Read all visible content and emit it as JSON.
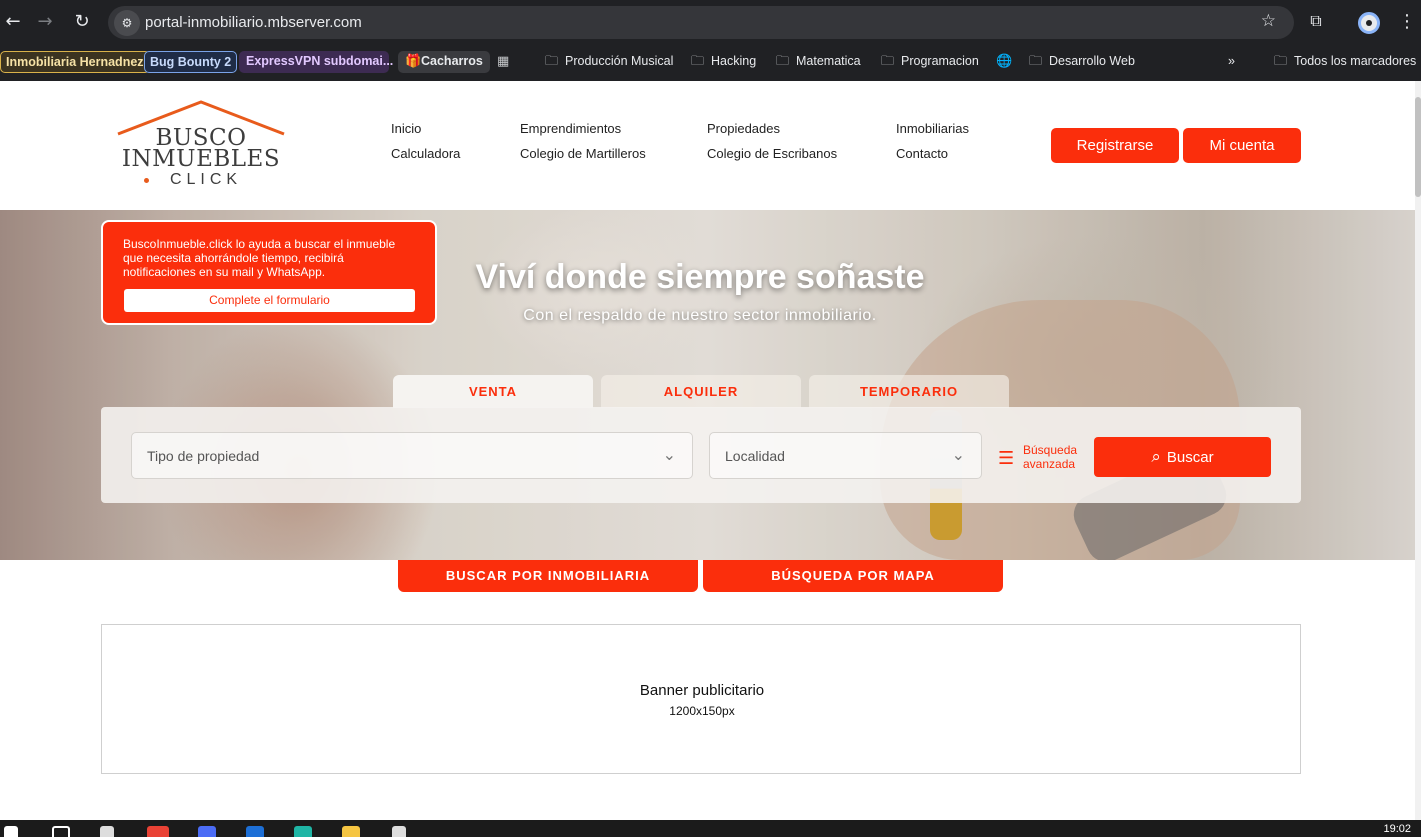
{
  "browser": {
    "url": "portal-inmobiliario.mbserver.com",
    "bookmarks": [
      {
        "label": "Inmobiliaria Hernadnez",
        "icon": ""
      },
      {
        "label": "Bug Bounty 2",
        "icon": ""
      },
      {
        "label": "ExpressVPN subdomai...",
        "icon": ""
      },
      {
        "label": "Cacharros",
        "icon": "gift-icon"
      },
      {
        "label": "Producción Musical",
        "icon": "folder-icon"
      },
      {
        "label": "Hacking",
        "icon": "folder-icon"
      },
      {
        "label": "Matematica",
        "icon": "folder-icon"
      },
      {
        "label": "Programacion",
        "icon": "folder-icon"
      },
      {
        "label": "Desarrollo Web",
        "icon": "folder-icon"
      },
      {
        "label": "Todos los marcadores",
        "icon": "folder-icon"
      }
    ],
    "more_chevron": "»"
  },
  "logo": {
    "line1": "BUSCO",
    "line2": "INMUEBLES",
    "line3": "CLICK"
  },
  "nav": {
    "col1": [
      "Inicio",
      "Calculadora"
    ],
    "col2": [
      "Emprendimientos",
      "Colegio de Martilleros"
    ],
    "col3": [
      "Propiedades",
      "Colegio de Escribanos"
    ],
    "col4": [
      "Inmobiliarias",
      "Contacto"
    ],
    "register": "Registrarse",
    "account": "Mi cuenta"
  },
  "hero": {
    "title": "Viví donde siempre soñaste",
    "subtitle": "Con el respaldo de nuestro sector inmobiliario."
  },
  "promo": {
    "text": "BuscoInmueble.click lo ayuda a buscar el inmueble que necesita ahorrándole tiempo, recibirá notificaciones en su mail y WhatsApp.",
    "button": "Complete el formulario"
  },
  "search": {
    "tabs": [
      "VENTA",
      "ALQUILER",
      "TEMPORARIO"
    ],
    "active_tab": "VENTA",
    "property_type_placeholder": "Tipo de propiedad",
    "location_placeholder": "Localidad",
    "advanced_label": "Búsqueda avanzada",
    "search_button": "Buscar"
  },
  "secondary_buttons": {
    "by_agency": "BUSCAR POR INMOBILIARIA",
    "by_map": "BÚSQUEDA POR MAPA"
  },
  "banner": {
    "title": "Banner publicitario",
    "size": "1200x150px"
  },
  "taskbar": {
    "clock": "19:02"
  },
  "colors": {
    "accent": "#fb2e0c",
    "chrome_bg": "#202124",
    "logo_roof": "#e85b1c"
  }
}
